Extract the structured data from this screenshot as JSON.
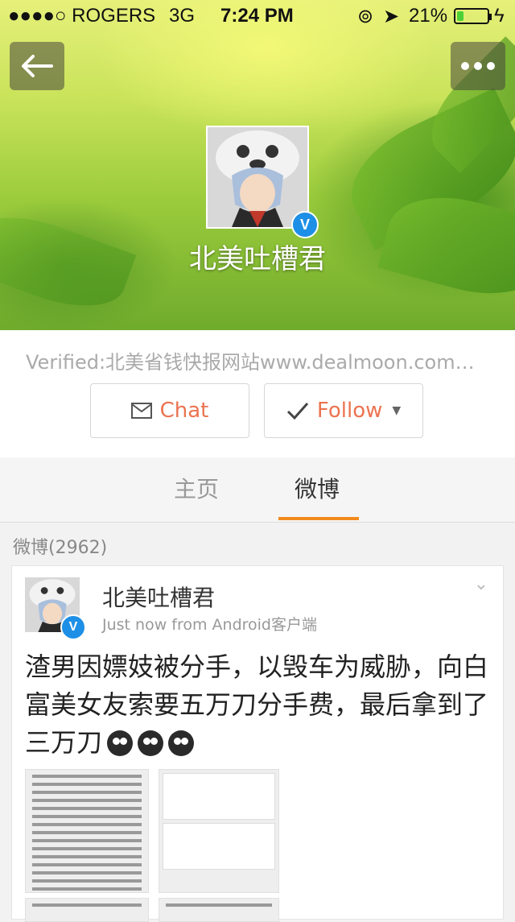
{
  "status_bar": {
    "carrier": "●●●●○ ROGERS",
    "network": "3G",
    "time": "7:24 PM",
    "battery": "21%",
    "battery_level": 0.21
  },
  "header": {
    "back_icon": "arrow-left-icon",
    "more_icon": "more-dots-icon",
    "name": "北美吐槽君",
    "verified_badge": "V"
  },
  "profile": {
    "verified_text": "Verified:北美省钱快报网站www.dealmoon.com旗下…",
    "chat_label": "Chat",
    "follow_label": "Follow"
  },
  "tabs": [
    "主页",
    "微博"
  ],
  "active_tab": 1,
  "weibo_count": "微博(2962)",
  "post": {
    "author": "北美吐槽君",
    "verified_badge": "V",
    "meta": "Just now  from Android客户端",
    "text": "渣男因嫖妓被分手，以毁车为威胁，向白富美女友索要五万刀分手费，最后拿到了三万刀"
  },
  "colors": {
    "accent": "#eb7350",
    "tab_underline": "#f28b1e",
    "verified": "#1e8fe6"
  }
}
